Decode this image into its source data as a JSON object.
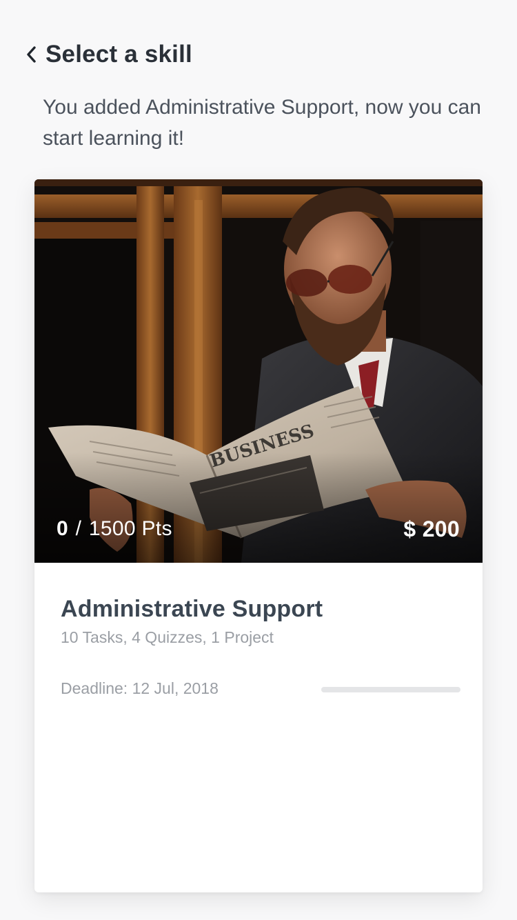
{
  "header": {
    "title": "Select a skill",
    "back_icon": "chevron-left-icon"
  },
  "subtitle": "You added Administrative Support, now you can start learning it!",
  "card": {
    "image_alt": "Man reading a newspaper",
    "points_current": "0",
    "points_separator": "/",
    "points_total": "1500 Pts",
    "price": "$ 200",
    "skill_name": "Administrative Support",
    "skill_meta": "10 Tasks, 4 Quizzes, 1 Project",
    "deadline": "Deadline: 12 Jul, 2018",
    "progress_fraction": 0,
    "newspaper_headline": "BUSINESS"
  },
  "colors": {
    "background": "#f8f8f9",
    "text_primary": "#2a3038",
    "text_secondary": "#9a9ea4",
    "progress_track": "#e4e5e7"
  }
}
